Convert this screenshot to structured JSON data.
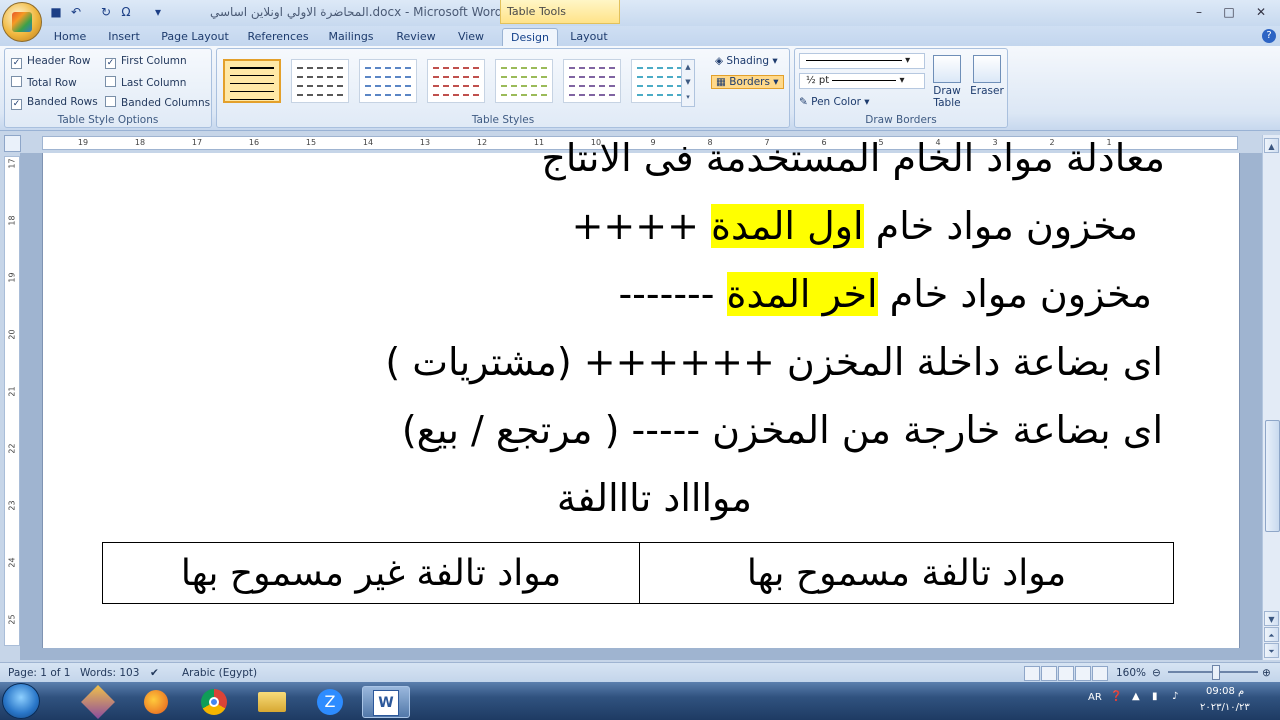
{
  "window": {
    "title": "المحاضرة الاولي اونلاين اساسي.docx - Microsoft Word",
    "contextual_tab": "Table Tools",
    "controls": [
      "minimize-icon",
      "maximize-icon",
      "close-icon"
    ]
  },
  "quick_access": [
    "save-icon",
    "undo-icon",
    "redo-icon",
    "omega-icon",
    "customize-icon"
  ],
  "tabs": [
    {
      "label": "Home",
      "active": false
    },
    {
      "label": "Insert",
      "active": false
    },
    {
      "label": "Page Layout",
      "active": false
    },
    {
      "label": "References",
      "active": false
    },
    {
      "label": "Mailings",
      "active": false
    },
    {
      "label": "Review",
      "active": false
    },
    {
      "label": "View",
      "active": false
    },
    {
      "label": "Design",
      "active": true
    },
    {
      "label": "Layout",
      "active": false
    }
  ],
  "ribbon": {
    "table_style_options": {
      "label": "Table Style Options",
      "options": [
        {
          "label": "Header Row",
          "checked": true
        },
        {
          "label": "First Column",
          "checked": true
        },
        {
          "label": "Total Row",
          "checked": false
        },
        {
          "label": "Last Column",
          "checked": false
        },
        {
          "label": "Banded Rows",
          "checked": true
        },
        {
          "label": "Banded Columns",
          "checked": false
        }
      ]
    },
    "table_styles": {
      "label": "Table Styles",
      "shading": "Shading",
      "borders": "Borders",
      "swatch_colors": [
        "#000000",
        "#595959",
        "#5b86c5",
        "#c0504d",
        "#9bbb59",
        "#8064a2",
        "#4bacc6"
      ]
    },
    "draw_borders": {
      "label": "Draw Borders",
      "line_weight": "½ pt",
      "pen_color": "Pen Color",
      "draw_table_line1": "Draw",
      "draw_table_line2": "Table",
      "eraser": "Eraser"
    }
  },
  "ruler": {
    "numbers": [
      "19",
      "18",
      "17",
      "16",
      "15",
      "14",
      "13",
      "12",
      "11",
      "10",
      "9",
      "8",
      "7",
      "6",
      "5",
      "4",
      "3",
      "2",
      "1"
    ],
    "vertical_numbers": [
      "17",
      "18",
      "19",
      "20",
      "21",
      "22",
      "23",
      "24",
      "25"
    ]
  },
  "document": {
    "line0": "معادلة مواد الخام المستخدمة فى الانتاج",
    "line1_a": "مخزون مواد خام ",
    "line1_hl": "اول المدة",
    "line1_b": " ++++",
    "line2_a": "مخزون مواد خام ",
    "line2_hl": "اخر المدة",
    "line2_b": " -------",
    "line3": "اى بضاعة داخلة المخزن ++++++ (مشتريات )",
    "line4": "اى بضاعة خارجة من المخزن ----- ( مرتجع / بيع)",
    "line5": "مواااد تااالفة",
    "highlight_color": "#ffff00",
    "table": {
      "cells": [
        "مواد تالفة مسموح بها",
        "مواد تالفة غير مسموح بها"
      ]
    }
  },
  "status_bar": {
    "page": "Page: 1 of 1",
    "words": "Words: 103",
    "language": "Arabic (Egypt)",
    "zoom": "160%"
  },
  "taskbar": {
    "apps": [
      "winrar-icon",
      "firefox-icon",
      "chrome-icon",
      "explorer-icon",
      "zoom-icon",
      "word-icon"
    ],
    "lang": "AR",
    "time": "09:08 م",
    "date": "٢٠٢٣/١٠/٢٣"
  }
}
